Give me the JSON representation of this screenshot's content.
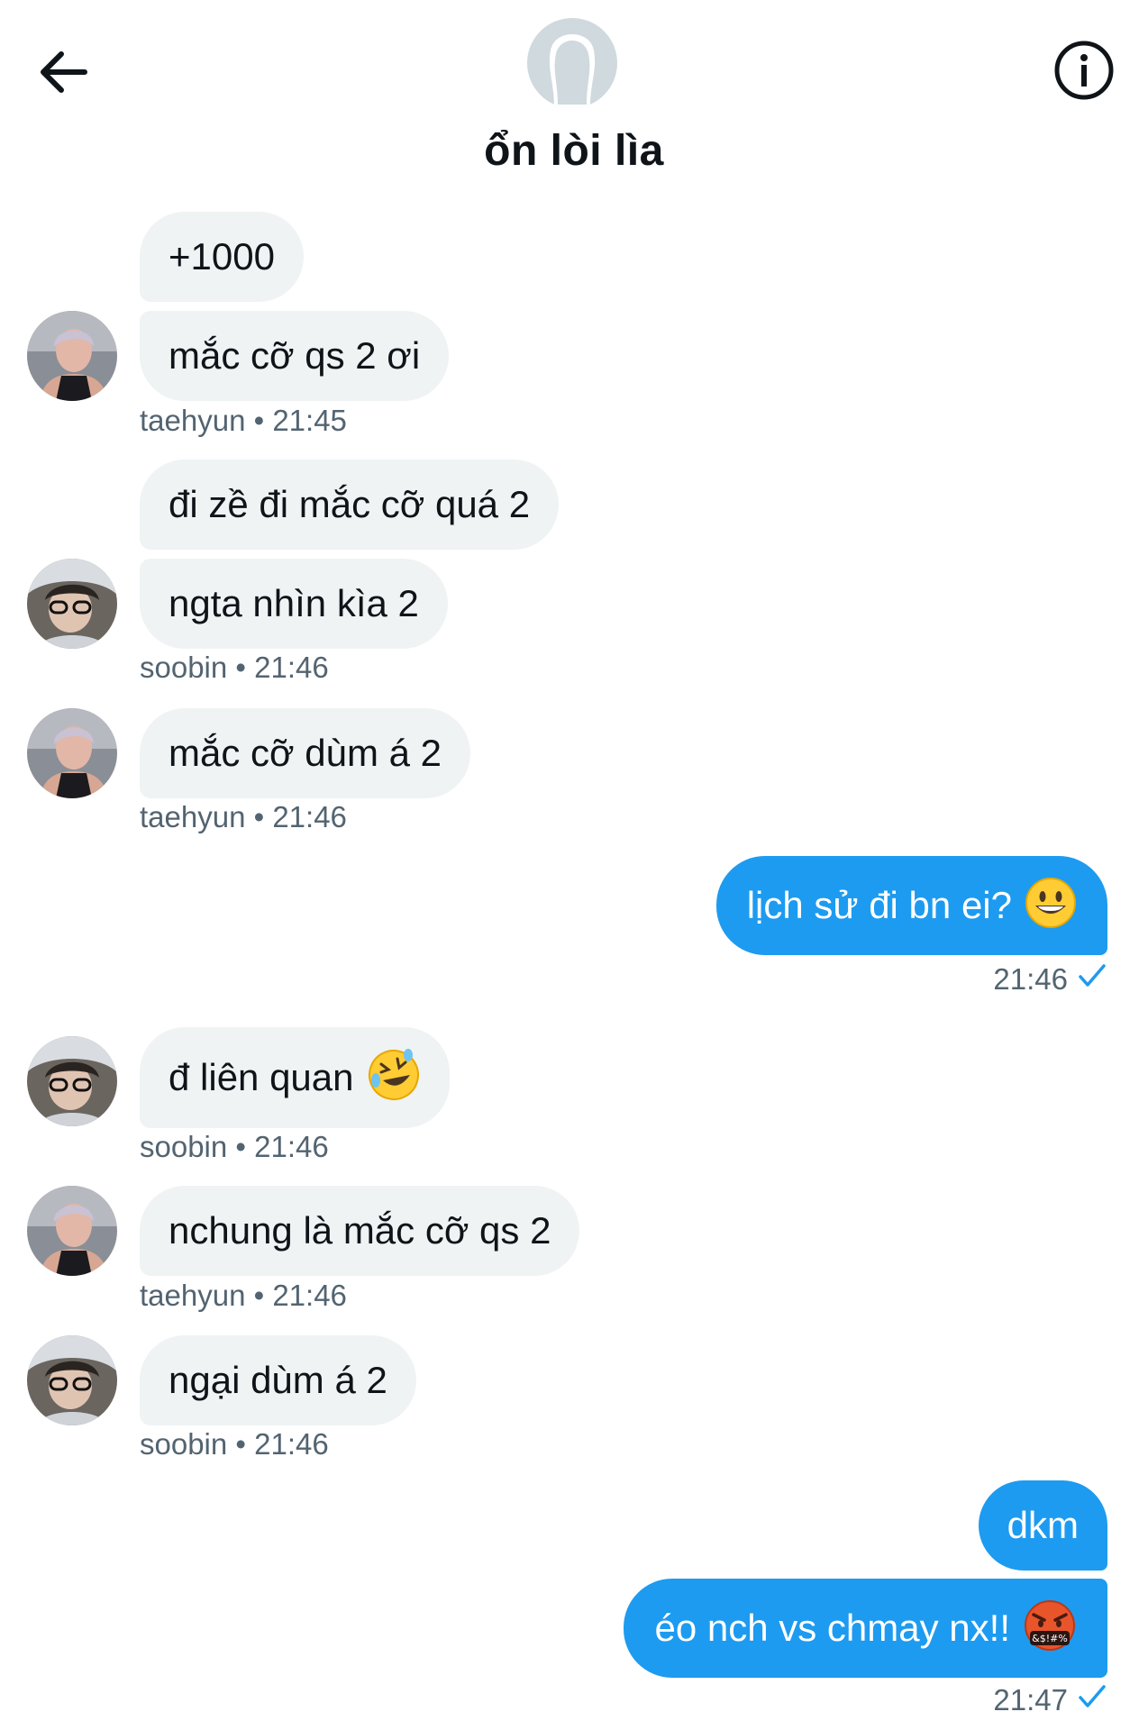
{
  "header": {
    "title": "ổn lòi lìa"
  },
  "messages": [
    {
      "id": "m1",
      "side": "in",
      "text": "+1000"
    },
    {
      "id": "m2",
      "side": "in",
      "text": "mắc cỡ qs 2 ơi",
      "sender": "taehyun",
      "time": "21:45",
      "meta": "taehyun • 21:45"
    },
    {
      "id": "m3",
      "side": "in",
      "text": "đi zề đi mắc cỡ quá 2"
    },
    {
      "id": "m4",
      "side": "in",
      "text": "ngta nhìn kìa 2",
      "sender": "soobin",
      "time": "21:46",
      "meta": "soobin • 21:46"
    },
    {
      "id": "m5",
      "side": "in",
      "text": "mắc cỡ dùm á 2",
      "sender": "taehyun",
      "time": "21:46",
      "meta": "taehyun • 21:46"
    },
    {
      "id": "m6",
      "side": "out",
      "text": "lịch sử đi bn ei?",
      "emoji": "grinning-face",
      "time": "21:46"
    },
    {
      "id": "m7",
      "side": "in",
      "text": "đ liên quan",
      "emoji": "rolling-on-floor-laughing",
      "sender": "soobin",
      "time": "21:46",
      "meta": "soobin • 21:46"
    },
    {
      "id": "m8",
      "side": "in",
      "text": "nchung là mắc cỡ qs 2",
      "sender": "taehyun",
      "time": "21:46",
      "meta": "taehyun • 21:46"
    },
    {
      "id": "m9",
      "side": "in",
      "text": "ngại dùm á 2",
      "sender": "soobin",
      "time": "21:46",
      "meta": "soobin • 21:46"
    },
    {
      "id": "m10",
      "side": "out",
      "text": "dkm"
    },
    {
      "id": "m11",
      "side": "out",
      "text": "éo nch vs chmay nx!!",
      "emoji": "face-with-symbols-on-mouth",
      "time": "21:47"
    }
  ],
  "icons": {
    "back": "arrow-left-icon",
    "info": "info-icon",
    "read": "checkmark-icon"
  },
  "colors": {
    "accent": "#1d9bf0",
    "incoming_bubble": "#eff3f4",
    "meta_text": "#536471"
  }
}
